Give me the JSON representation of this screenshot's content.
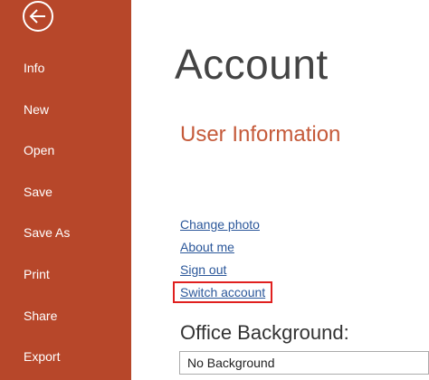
{
  "sidebar": {
    "items": [
      {
        "label": "Info"
      },
      {
        "label": "New"
      },
      {
        "label": "Open"
      },
      {
        "label": "Save"
      },
      {
        "label": "Save As"
      },
      {
        "label": "Print"
      },
      {
        "label": "Share"
      },
      {
        "label": "Export"
      }
    ],
    "back_icon": "back-arrow-circle-icon",
    "background_color": "#b7472a"
  },
  "main": {
    "title": "Account",
    "user_info_heading": "User Information",
    "links": {
      "change_photo": "Change photo",
      "about_me": "About me",
      "sign_out": "Sign out",
      "switch_account": "Switch account"
    },
    "office_background": {
      "label": "Office Background:",
      "selected": "No Background"
    },
    "accent_color": "#c55a3a",
    "link_color": "#2b579a",
    "highlight_color": "#e0201f"
  }
}
